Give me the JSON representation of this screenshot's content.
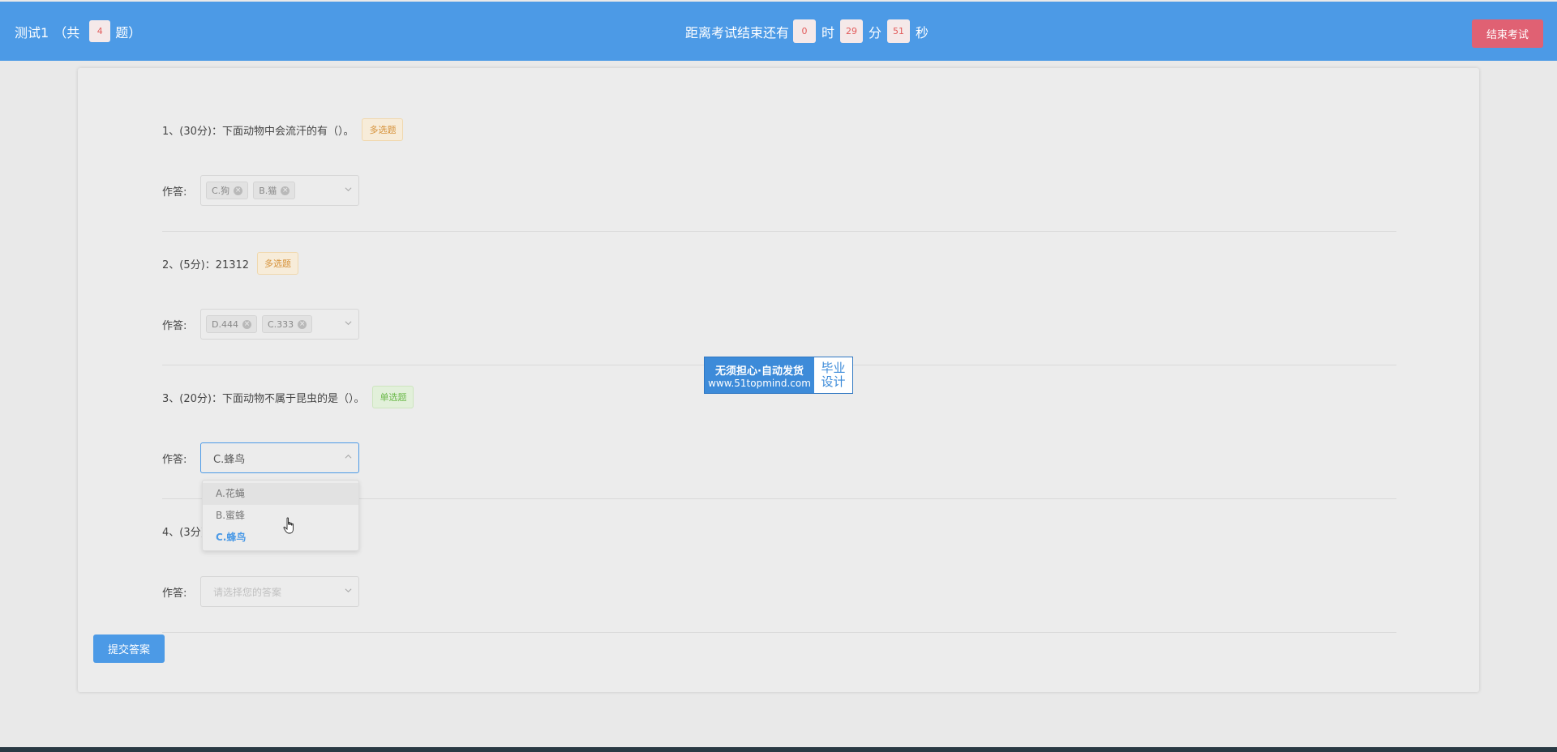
{
  "header": {
    "test_name": "测试1",
    "count_open": "（共",
    "question_count": "4",
    "count_close": "题）",
    "timer_label": "距离考试结束还有",
    "hours": "0",
    "hours_unit": "时",
    "minutes": "29",
    "minutes_unit": "分",
    "seconds": "51",
    "seconds_unit": "秒",
    "end_button": "结束考试"
  },
  "answer_label": "作答:",
  "questions": [
    {
      "text": "1、(30分)：下面动物中会流汗的有（）。",
      "type_tag": "多选题",
      "selected": [
        "C.狗",
        "B.猫"
      ]
    },
    {
      "text": "2、(5分)：21312",
      "type_tag": "多选题",
      "selected": [
        "D.444",
        "C.333"
      ]
    },
    {
      "text": "3、(20分)：下面动物不属于昆虫的是（）。",
      "type_tag": "单选题",
      "value": "C.蜂鸟",
      "options": [
        "A.花蝇",
        "B.蜜蜂",
        "C.蜂鸟"
      ]
    },
    {
      "text": "4、(3分)",
      "placeholder": "请选择您的答案"
    }
  ],
  "submit_button": "提交答案",
  "watermark": {
    "line1": "无须担心·自动发货",
    "line2": "www.51topmind.com",
    "right1": "毕业",
    "right2": "设计"
  },
  "colors": {
    "header_bg": "#4c9ae6",
    "end_button": "#e06173",
    "accent": "#4c9ae6",
    "multi_tag": "#d6923a",
    "single_tag": "#6cb94a"
  }
}
